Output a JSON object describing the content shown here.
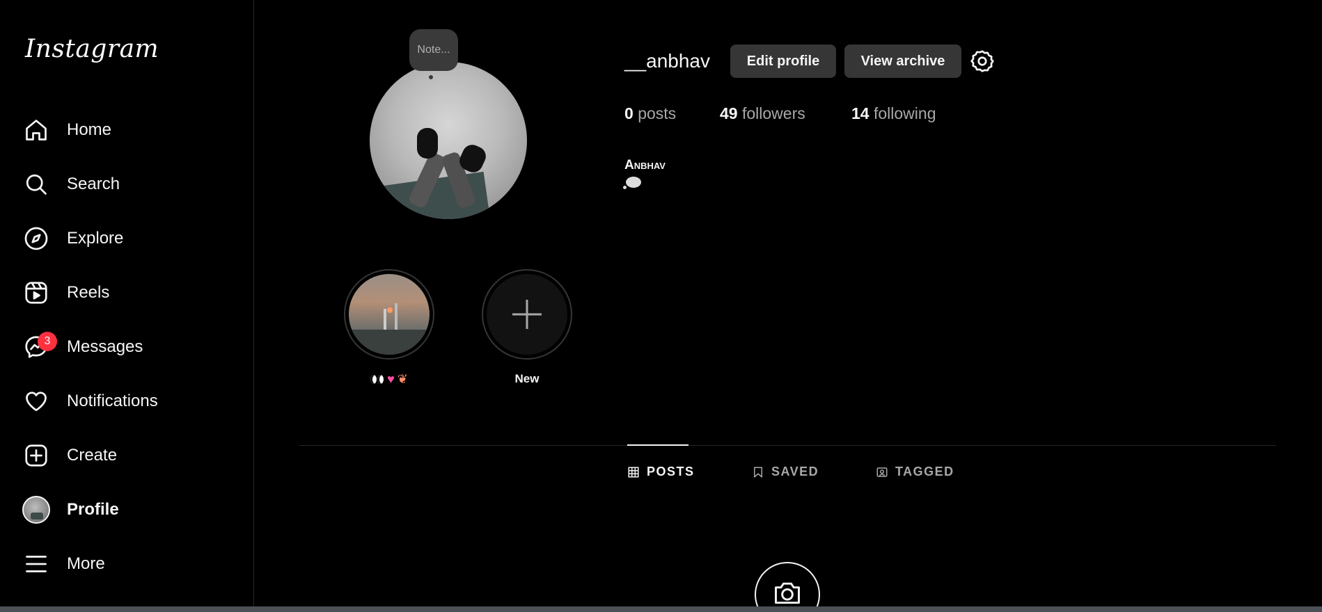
{
  "app": {
    "logo_text": "Instagram"
  },
  "sidebar": {
    "items": [
      {
        "label": "Home",
        "icon": "home-icon"
      },
      {
        "label": "Search",
        "icon": "search-icon"
      },
      {
        "label": "Explore",
        "icon": "compass-icon"
      },
      {
        "label": "Reels",
        "icon": "reels-icon"
      },
      {
        "label": "Messages",
        "icon": "messenger-icon",
        "badge": "3"
      },
      {
        "label": "Notifications",
        "icon": "heart-icon"
      },
      {
        "label": "Create",
        "icon": "plus-square-icon"
      },
      {
        "label": "Profile",
        "icon": "avatar"
      },
      {
        "label": "More",
        "icon": "menu-icon"
      }
    ]
  },
  "profile": {
    "note_placeholder": "Note...",
    "username": "__anbhav",
    "edit_profile_label": "Edit profile",
    "view_archive_label": "View archive",
    "stats": {
      "posts_count": "0",
      "posts_label": "posts",
      "followers_count": "49",
      "followers_label": "followers",
      "following_count": "14",
      "following_label": "following"
    },
    "full_name": "Anbhav"
  },
  "highlights": {
    "new_label": "New"
  },
  "tabs": [
    {
      "label": "POSTS",
      "icon": "grid-icon",
      "active": true
    },
    {
      "label": "SAVED",
      "icon": "bookmark-icon",
      "active": false
    },
    {
      "label": "TAGGED",
      "icon": "tag-icon",
      "active": false
    }
  ],
  "colors": {
    "background": "#000000",
    "button_bg": "#363636",
    "badge": "#ff3040",
    "muted_text": "#a8a8a8"
  }
}
